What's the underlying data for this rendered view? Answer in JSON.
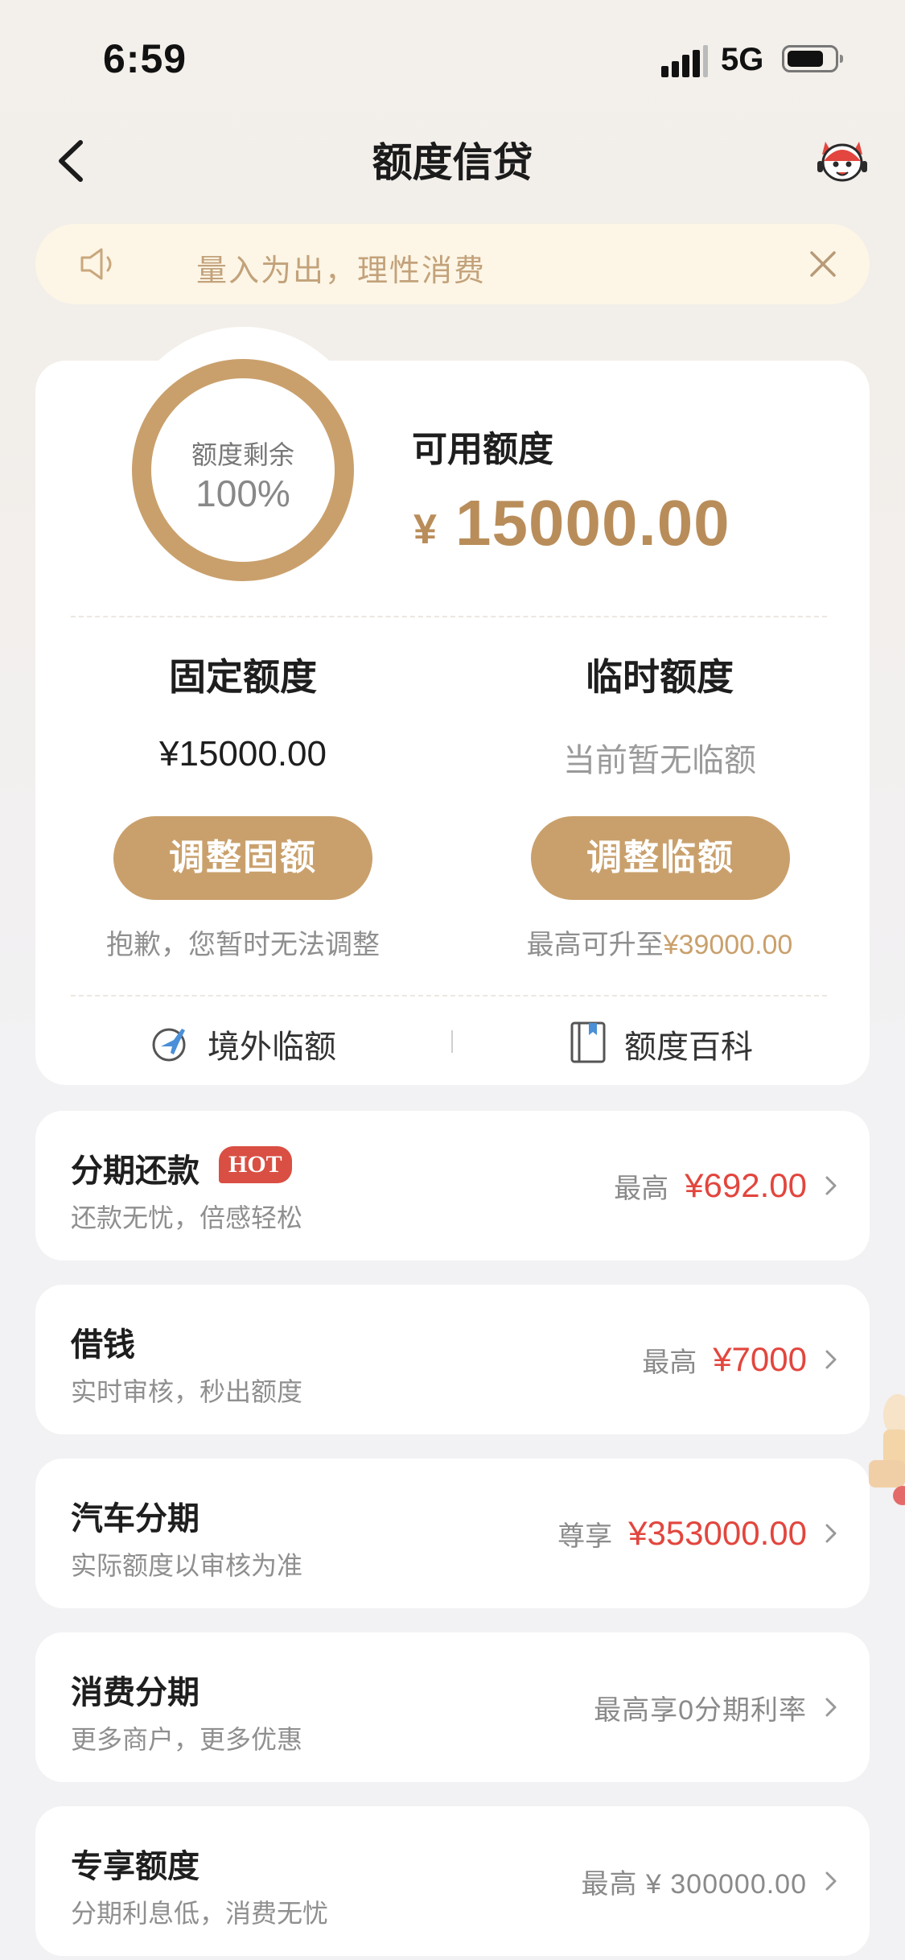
{
  "status_bar": {
    "time": "6:59",
    "network": "5G"
  },
  "header": {
    "title": "额度信贷",
    "back_icon": "chevron-left-icon",
    "service_icon": "mascot-icon"
  },
  "notice": {
    "text": "量入为出，理性消费",
    "icon": "speaker-icon",
    "close_icon": "close-icon"
  },
  "credit": {
    "ring_label": "额度剩余",
    "ring_value": "100%",
    "ring_fraction": 1.0,
    "available_label": "可用额度",
    "currency_symbol": "¥",
    "available_amount": "15000.00",
    "fixed": {
      "title": "固定额度",
      "value": "¥15000.00",
      "button": "调整固额",
      "note": "抱歉，您暂时无法调整"
    },
    "temporary": {
      "title": "临时额度",
      "value": "当前暂无临额",
      "button": "调整临额",
      "note_prefix": "最高可升至",
      "note_amount": "¥39000.00"
    },
    "links": {
      "overseas": "境外临额",
      "wiki": "额度百科"
    }
  },
  "products": [
    {
      "title": "分期还款",
      "badge": "HOT",
      "subtitle": "还款无忧，倍感轻松",
      "prefix": "最高",
      "amount": "¥692.00"
    },
    {
      "title": "借钱",
      "subtitle": "实时审核，秒出额度",
      "prefix": "最高",
      "amount": "¥7000"
    },
    {
      "title": "汽车分期",
      "subtitle": "实际额度以审核为准",
      "prefix": "尊享",
      "amount": "¥353000.00"
    },
    {
      "title": "消费分期",
      "subtitle": "更多商户，更多优惠",
      "desc": "最高享0分期利率"
    },
    {
      "title": "专享额度",
      "subtitle": "分期利息低，消费无忧",
      "desc": "最高 ¥ 300000.00"
    }
  ],
  "colors": {
    "gold": "#c9a06c",
    "gold_text": "#b98d5a",
    "red": "#e2463e",
    "notice_bg": "#fdf6e6",
    "hot_badge": "#d94f43"
  }
}
